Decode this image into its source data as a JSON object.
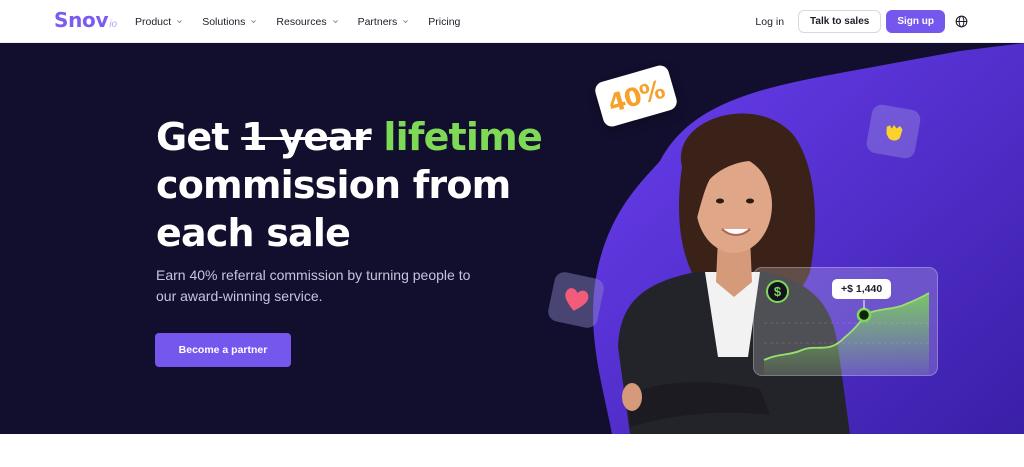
{
  "nav": {
    "logo_main": "Snov",
    "logo_suffix": "io",
    "menu": [
      {
        "label": "Product",
        "dropdown": true
      },
      {
        "label": "Solutions",
        "dropdown": true
      },
      {
        "label": "Resources",
        "dropdown": true
      },
      {
        "label": "Partners",
        "dropdown": true
      },
      {
        "label": "Pricing",
        "dropdown": false
      }
    ],
    "login": "Log in",
    "talk_to_sales": "Talk to sales",
    "sign_up": "Sign up",
    "language_icon": "globe-icon"
  },
  "hero": {
    "headline_prefix": "Get",
    "headline_struck": "1 year",
    "headline_highlight": "lifetime",
    "headline_line2": "commission from",
    "headline_line3": "each sale",
    "subtext": "Earn 40% referral commission by turning people to our award-winning service.",
    "cta": "Become a partner"
  },
  "decorations": {
    "percent_badge": "40%",
    "earnings_amount": "+$ 1,440",
    "dollar_symbol": "$",
    "icons": [
      "heart-icon",
      "hand-icon",
      "dollar-icon"
    ]
  },
  "colors": {
    "brand": "#7657ee",
    "hero_bg": "#120f2e",
    "highlight_green": "#7ed957",
    "badge_orange": "#f7a12a"
  }
}
